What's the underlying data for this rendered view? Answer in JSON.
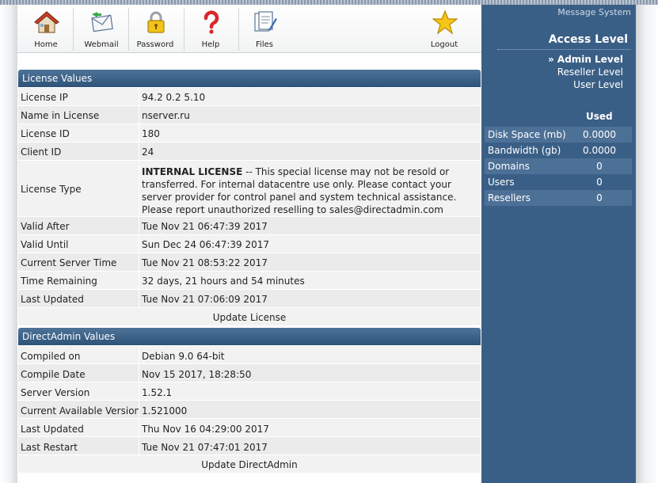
{
  "toolbar": {
    "items": [
      {
        "label": "Home",
        "icon": "home-icon"
      },
      {
        "label": "Webmail",
        "icon": "webmail-icon"
      },
      {
        "label": "Password",
        "icon": "padlock-icon"
      },
      {
        "label": "Help",
        "icon": "help-icon"
      },
      {
        "label": "Files",
        "icon": "files-icon"
      },
      {
        "label": "Logout",
        "icon": "star-icon"
      }
    ]
  },
  "sidebar": {
    "message_system": "Message System",
    "access_level_title": "Access Level",
    "levels": [
      {
        "label": "» Admin Level",
        "active": true
      },
      {
        "label": "Reseller Level",
        "active": false
      },
      {
        "label": "User Level",
        "active": false
      }
    ],
    "used_header": "Used",
    "usage": [
      {
        "name": "Disk Space (mb)",
        "value": "0.0000"
      },
      {
        "name": "Bandwidth (gb)",
        "value": "0.0000"
      },
      {
        "name": "Domains",
        "value": "0"
      },
      {
        "name": "Users",
        "value": "0"
      },
      {
        "name": "Resellers",
        "value": "0"
      }
    ]
  },
  "license": {
    "title": "License Values",
    "rows": [
      {
        "key": "License IP",
        "value": "94.2  0.2  5.10"
      },
      {
        "key": "Name in License",
        "value": "nserver.ru"
      },
      {
        "key": "License ID",
        "value": "180"
      },
      {
        "key": "Client ID",
        "value": "24"
      }
    ],
    "type_key": "License Type",
    "type_bold": "INTERNAL LICENSE",
    "type_text": " -- This special license may not be resold or transferred. For internal datacentre use only. Please contact your server provider for control panel and system technical assistance. Please report unauthorized reselling to sales@directadmin.com",
    "rows2": [
      {
        "key": "Valid After",
        "value": "Tue Nov 21 06:47:39 2017"
      },
      {
        "key": "Valid Until",
        "value": "Sun Dec 24 06:47:39 2017"
      },
      {
        "key": "Current Server Time",
        "value": "Tue Nov 21 08:53:22 2017"
      },
      {
        "key": "Time Remaining",
        "value": "32 days, 21 hours and 54 minutes"
      },
      {
        "key": "Last Updated",
        "value": "Tue Nov 21 07:06:09 2017"
      }
    ],
    "update_label": "Update License"
  },
  "directadmin": {
    "title": "DirectAdmin Values",
    "rows": [
      {
        "key": "Compiled on",
        "value": "Debian 9.0 64-bit"
      },
      {
        "key": "Compile Date",
        "value": "Nov 15 2017, 18:28:50"
      },
      {
        "key": "Server Version",
        "value": "1.52.1"
      },
      {
        "key": "Current Available Version",
        "value": "1.521000"
      },
      {
        "key": "Last Updated",
        "value": "Thu Nov 16 04:29:00 2017"
      },
      {
        "key": "Last Restart",
        "value": "Tue Nov 21 07:47:01 2017"
      }
    ],
    "update_label": "Update DirectAdmin"
  }
}
